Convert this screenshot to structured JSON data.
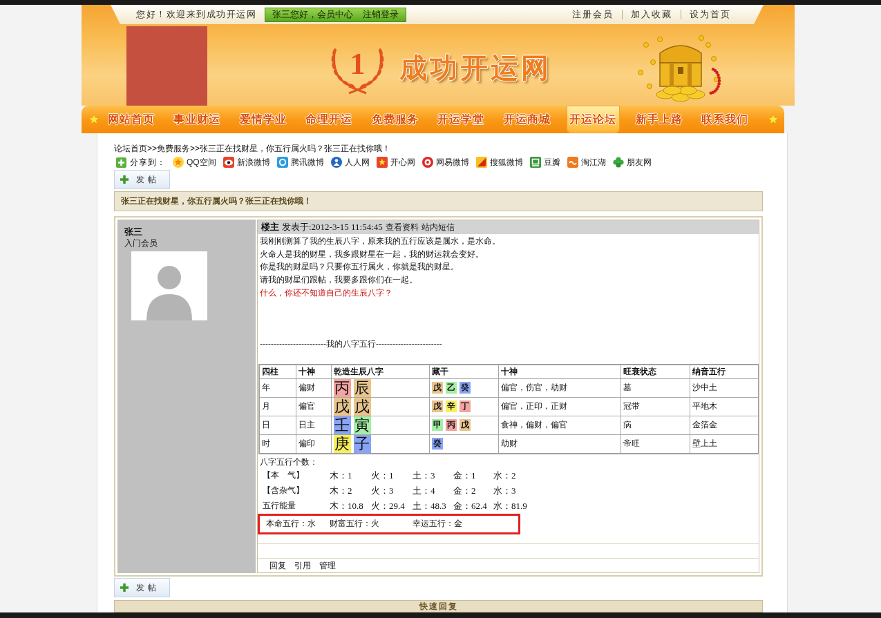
{
  "top_bar": {
    "greeting": "您好！欢迎来到成功开运网",
    "member_links": [
      "张三您好，会员中心",
      "注销登录"
    ],
    "links": [
      "注册会员",
      "加入收藏",
      "设为首页"
    ]
  },
  "header": {
    "logo_number": "1",
    "logo_text": "成功开运网"
  },
  "nav": [
    {
      "label": "网站首页",
      "selected": false
    },
    {
      "label": "事业财运",
      "selected": false
    },
    {
      "label": "爱情学业",
      "selected": false
    },
    {
      "label": "命理开运",
      "selected": false
    },
    {
      "label": "免费服务",
      "selected": false
    },
    {
      "label": "开运学堂",
      "selected": false
    },
    {
      "label": "开运商城",
      "selected": false
    },
    {
      "label": "开运论坛",
      "selected": true
    },
    {
      "label": "新手上路",
      "selected": false
    },
    {
      "label": "联系我们",
      "selected": false
    }
  ],
  "breadcrumb": "论坛首页>>免费服务>>张三正在找财星，你五行属火吗？张三正在找你哦！",
  "share": {
    "label": "分享到：",
    "sites": [
      "QQ空间",
      "新浪微博",
      "腾讯微博",
      "人人网",
      "开心网",
      "网易微博",
      "搜狐微博",
      "豆瓣",
      "淘江湖",
      "朋友网"
    ]
  },
  "new_post_button_top": "发 帖",
  "thread_title": "张三正在找财星，你五行属火吗？张三正在找你哦！",
  "post": {
    "author": "张三",
    "rank": "入门会员",
    "floor": "楼主",
    "posted": "发表于:2012-3-15 11:54:45",
    "header_links": [
      "查看资料",
      "站内短信"
    ],
    "paragraphs": [
      "我刚刚测算了我的生辰八字，原来我的五行应该是属水，是水命。",
      "火命人是我的财星，我多跟财星在一起，我的财运就会变好。",
      "你是我的财星吗？只要你五行属火，你就是我的财星。",
      "请我的财星们跟帖，我要多跟你们在一起。"
    ],
    "notice": "什么，你还不知道自己的生辰八字？",
    "section_heading": "------------------------我的八字五行------------------------",
    "bazi_table": {
      "columns": [
        "四柱",
        "十神",
        "乾造生辰八字",
        "藏干",
        "十神",
        "旺衰状态",
        "纳音五行"
      ],
      "rows": [
        {
          "pillar": "年",
          "ten_god": "偏财",
          "chars": [
            {
              "text": "丙",
              "color": "#f4a4a0"
            },
            {
              "text": "辰",
              "color": "#e8c48c"
            }
          ],
          "hidden_stems": [
            {
              "text": "戊",
              "color": "#e8c48c"
            },
            {
              "text": "乙",
              "color": "#a4eea4"
            },
            {
              "text": "癸",
              "color": "#88a4f4"
            }
          ],
          "hidden_gods": "偏官，伤官，劫财",
          "vigor": "墓",
          "nayin": "沙中土"
        },
        {
          "pillar": "月",
          "ten_god": "偏官",
          "chars": [
            {
              "text": "戊",
              "color": "#e8c48c"
            },
            {
              "text": "戊",
              "color": "#e8c48c"
            }
          ],
          "hidden_stems": [
            {
              "text": "戊",
              "color": "#e8c48c"
            },
            {
              "text": "辛",
              "color": "#f8f058"
            },
            {
              "text": "丁",
              "color": "#f4a4a0"
            }
          ],
          "hidden_gods": "偏官，正印，正财",
          "vigor": "冠带",
          "nayin": "平地木"
        },
        {
          "pillar": "日",
          "ten_god": "日主",
          "chars": [
            {
              "text": "壬",
              "color": "#88a4f4"
            },
            {
              "text": "寅",
              "color": "#a4eea4"
            }
          ],
          "hidden_stems": [
            {
              "text": "甲",
              "color": "#a4eea4"
            },
            {
              "text": "丙",
              "color": "#f4a4a0"
            },
            {
              "text": "戊",
              "color": "#e8c48c"
            }
          ],
          "hidden_gods": "食神，偏财，偏官",
          "vigor": "病",
          "nayin": "金箔金"
        },
        {
          "pillar": "时",
          "ten_god": "偏印",
          "chars": [
            {
              "text": "庚",
              "color": "#f8f058"
            },
            {
              "text": "子",
              "color": "#88a4f4"
            }
          ],
          "hidden_stems": [
            {
              "text": "癸",
              "color": "#88a4f4"
            }
          ],
          "hidden_gods": "劫财",
          "vigor": "帝旺",
          "nayin": "壁上土"
        }
      ]
    },
    "counts_heading": "八字五行个数：",
    "counts": [
      {
        "label": "【本　气】",
        "values": [
          "木：1",
          "火：1",
          "土：3",
          "金：1",
          "水：2"
        ]
      },
      {
        "label": "【含杂气】",
        "values": [
          "木：2",
          "火：3",
          "土：4",
          "金：2",
          "水：3"
        ]
      },
      {
        "label": "五行能量",
        "values": [
          "木：10.8",
          "火：29.4",
          "土：48.3",
          "金：62.4",
          "水：81.9"
        ]
      }
    ],
    "summary": [
      "本命五行：水",
      "财富五行：火",
      "幸运五行：金"
    ],
    "actions": [
      "回复",
      "引用",
      "管理"
    ]
  },
  "new_post_button_bottom": "发 帖",
  "quick_reply": "快速回复"
}
